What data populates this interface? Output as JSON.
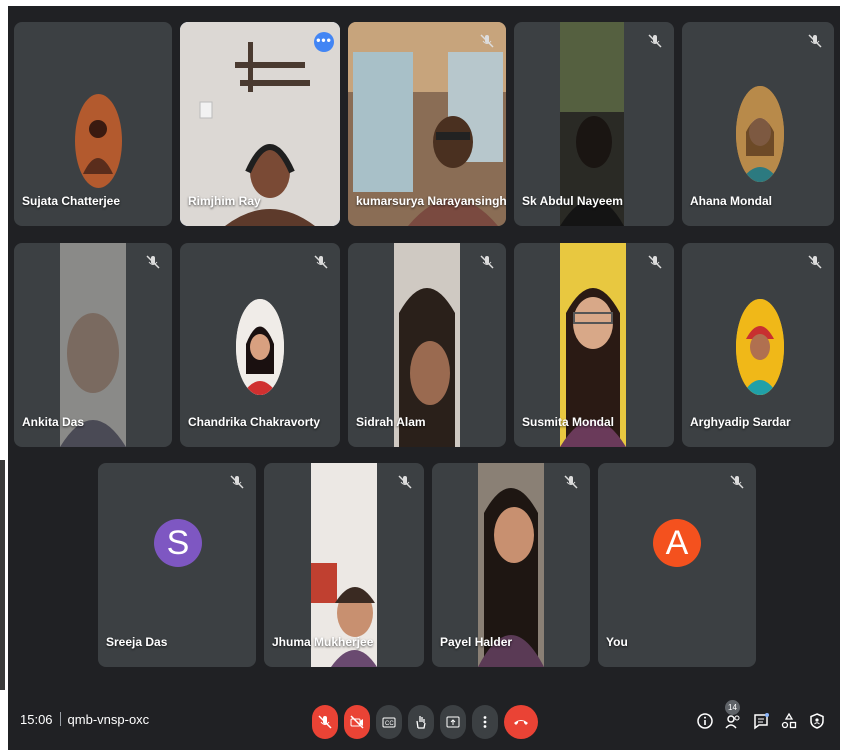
{
  "participants": [
    {
      "name": "Sujata Chatterjee"
    },
    {
      "name": "Rimjhim Ray",
      "more_label": "•••"
    },
    {
      "name": "kumarsurya Narayansingh"
    },
    {
      "name": "Sk Abdul Nayeem"
    },
    {
      "name": "Ahana Mondal"
    },
    {
      "name": "Ankita Das"
    },
    {
      "name": "Chandrika Chakravorty"
    },
    {
      "name": "Sidrah Alam"
    },
    {
      "name": "Susmita Mondal"
    },
    {
      "name": "Arghyadip Sardar"
    },
    {
      "name": "Sreeja Das",
      "initial": "S"
    },
    {
      "name": "Jhuma Mukherjee"
    },
    {
      "name": "Payel Halder"
    },
    {
      "name": "You",
      "initial": "A"
    }
  ],
  "bottom_bar": {
    "time": "15:06",
    "meeting_code": "qmb-vnsp-oxc",
    "participant_count": "14"
  },
  "colors": {
    "background": "#202124",
    "tile": "#3c4043",
    "danger": "#ea4335",
    "speaking_outline": "#8ab4f8",
    "avatar_s": "#7e57c2",
    "avatar_a": "#f4511e"
  },
  "icons": [
    "mic-off-icon",
    "camera-off-icon",
    "captions-icon",
    "raise-hand-icon",
    "present-icon",
    "more-vert-icon",
    "call-end-icon",
    "info-icon",
    "people-icon",
    "chat-icon",
    "activities-icon",
    "host-controls-icon"
  ]
}
